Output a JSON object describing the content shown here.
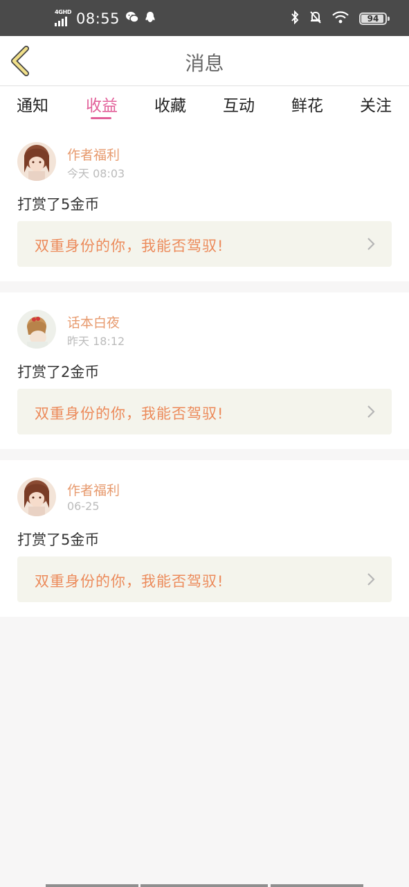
{
  "status_bar": {
    "network": "4GHD",
    "time": "08:55",
    "battery": "94",
    "battery_level": 0.94,
    "icons": [
      "wechat-icon",
      "qq-icon",
      "bluetooth-icon",
      "mute-bell-icon",
      "wifi-icon"
    ]
  },
  "header": {
    "title": "消息"
  },
  "tabs": [
    {
      "label": "通知"
    },
    {
      "label": "收益",
      "active": true
    },
    {
      "label": "收藏"
    },
    {
      "label": "互动"
    },
    {
      "label": "鲜花"
    },
    {
      "label": "关注"
    }
  ],
  "items": [
    {
      "name": "作者福利",
      "time": "今天 08:03",
      "message": "打赏了5金币",
      "book": "双重身份的你，我能否驾驭!"
    },
    {
      "name": "话本白夜",
      "time": "昨天 18:12",
      "message": "打赏了2金币",
      "book": "双重身份的你，我能否驾驭!"
    },
    {
      "name": "作者福利",
      "time": "06-25",
      "message": "打赏了5金币",
      "book": "双重身份的你，我能否驾驭!"
    }
  ],
  "colors": {
    "accent": "#e25f99",
    "name": "#e79a6e",
    "book_title": "#ec8a5a",
    "status_bar": "#4a4a4a"
  }
}
